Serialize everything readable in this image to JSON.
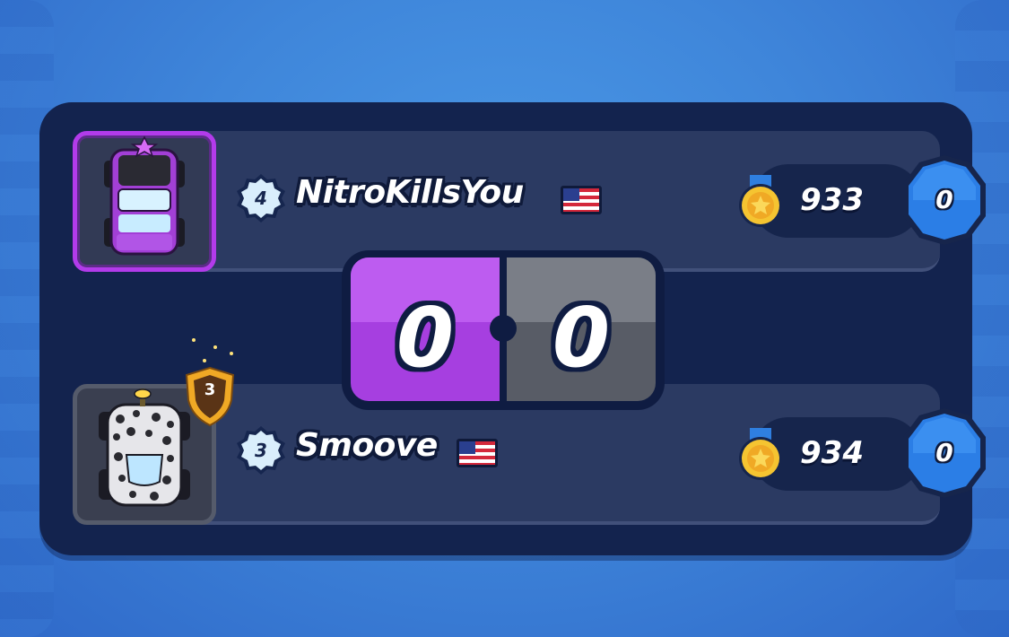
{
  "colors": {
    "background": "#3f86da",
    "panel": "#13234e",
    "row": "#2b3a62",
    "player_one_accent": "#b23bea",
    "player_two_accent": "#585c66",
    "round_badge": "#2b7ee6",
    "coin": "#f5c431"
  },
  "players": [
    {
      "name": "NitroKillsYou",
      "level": "4",
      "flag": "us-flag",
      "trophies": "933",
      "rounds_won": "0",
      "car_icon": "purple-monster-truck-icon"
    },
    {
      "name": "Smoove",
      "level": "3",
      "flag": "us-flag",
      "trophies": "934",
      "rounds_won": "0",
      "rank_badge": "3",
      "car_icon": "leopard-print-car-icon"
    }
  ],
  "score": {
    "left": "0",
    "right": "0"
  }
}
